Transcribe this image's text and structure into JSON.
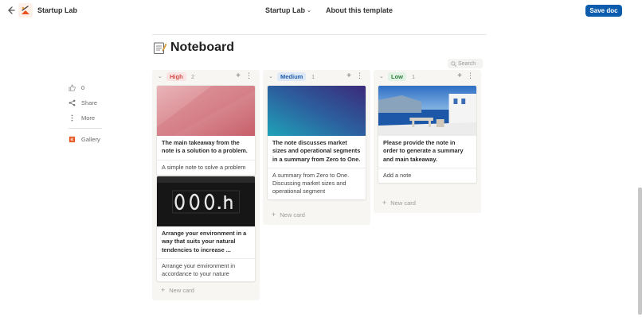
{
  "topbar": {
    "app_title": "Startup Lab",
    "nav_template": "Startup Lab",
    "nav_about": "About this template",
    "save_label": "Save doc"
  },
  "page": {
    "title": "Noteboard"
  },
  "search": {
    "placeholder": "Search"
  },
  "rail": {
    "likes": "0",
    "share": "Share",
    "more": "More",
    "gallery": "Gallery"
  },
  "columns": [
    {
      "label": "High",
      "count": "2",
      "cards": [
        {
          "title": "The main takeaway from the note is a solution to a problem.",
          "summary": "A simple note to solve a problem"
        },
        {
          "title": "Arrange your environment in a way that suits your natural tendencies to increase ...",
          "summary": "Arrange your environment in accordance to your nature"
        }
      ],
      "new_card": "New card"
    },
    {
      "label": "Medium",
      "count": "1",
      "cards": [
        {
          "title": "The note discusses market sizes and operational segments in a summary from Zero to One.",
          "summary": "A summary from Zero to One. Discussing market sizes and operational segment"
        }
      ],
      "new_card": "New card"
    },
    {
      "label": "Low",
      "count": "1",
      "cards": [
        {
          "title": "Please provide the note in order to generate a summary and main takeaway.",
          "summary": "Add a note"
        }
      ],
      "new_card": "New card"
    }
  ],
  "colors": {
    "save_button": "#0b5cad",
    "high_tag_bg": "#fbe4e4",
    "high_tag_text": "#d44c47",
    "medium_tag_bg": "#dde9f7",
    "medium_tag_text": "#1f5aa6",
    "low_tag_bg": "#e1f3e4",
    "low_tag_text": "#2f7d3c",
    "column_bg": "#f7f6f3"
  },
  "icons": [
    "back-arrow-icon",
    "app-logo-icon",
    "chevron-down-icon",
    "memo-icon",
    "search-icon",
    "thumbs-up-icon",
    "share-icon",
    "more-vertical-icon",
    "gallery-icon",
    "plus-icon"
  ]
}
